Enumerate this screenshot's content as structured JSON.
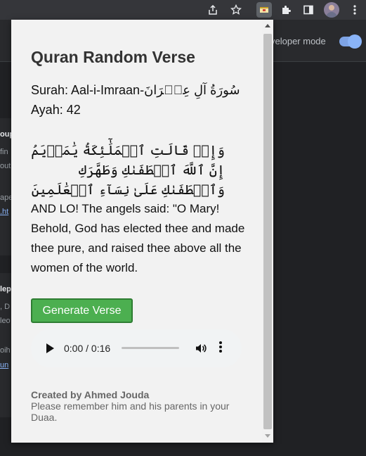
{
  "browser": {
    "icons": [
      "share-icon",
      "star-icon",
      "extension-quran-icon",
      "puzzle-icon",
      "sidepanel-icon",
      "avatar",
      "menu-icon"
    ]
  },
  "background_page": {
    "developer_mode_label": "veloper mode",
    "developer_mode_on": true,
    "card1_lines": [
      "oup",
      "fin",
      "out",
      "ape",
      ".ht"
    ],
    "card2_lines": [
      "lep",
      ", D",
      "leo",
      "oih",
      "un"
    ]
  },
  "popup": {
    "title": "Quran Random Verse",
    "surah_label": "Surah: Aal-i-Imraan-سُورَةُ آلِ عِمۡرَانَ",
    "ayah_label": "Ayah: 42",
    "arabic_text": "وَإِذۡ قَالَتِ ٱلۡمَلَٰٓئِكَةُ يَٰمَرۡيَمُ إِنَّ ٱللَّهَ ٱصۡطَفَىٰكِ وَطَهَّرَكِ وَٱصۡطَفَىٰكِ عَلَىٰ نِسَآءِ ٱلۡعَٰلَمِينَ",
    "translation": "AND LO! The angels said: \"O Mary! Behold, God has elected thee and made thee pure, and raised thee above all the women of the world.",
    "generate_button": "Generate Verse",
    "audio": {
      "time": "0:00 / 0:16",
      "progress": 0
    },
    "credit": "Created by Ahmed Jouda",
    "note": "Please remember him and his parents in your Duaa."
  }
}
